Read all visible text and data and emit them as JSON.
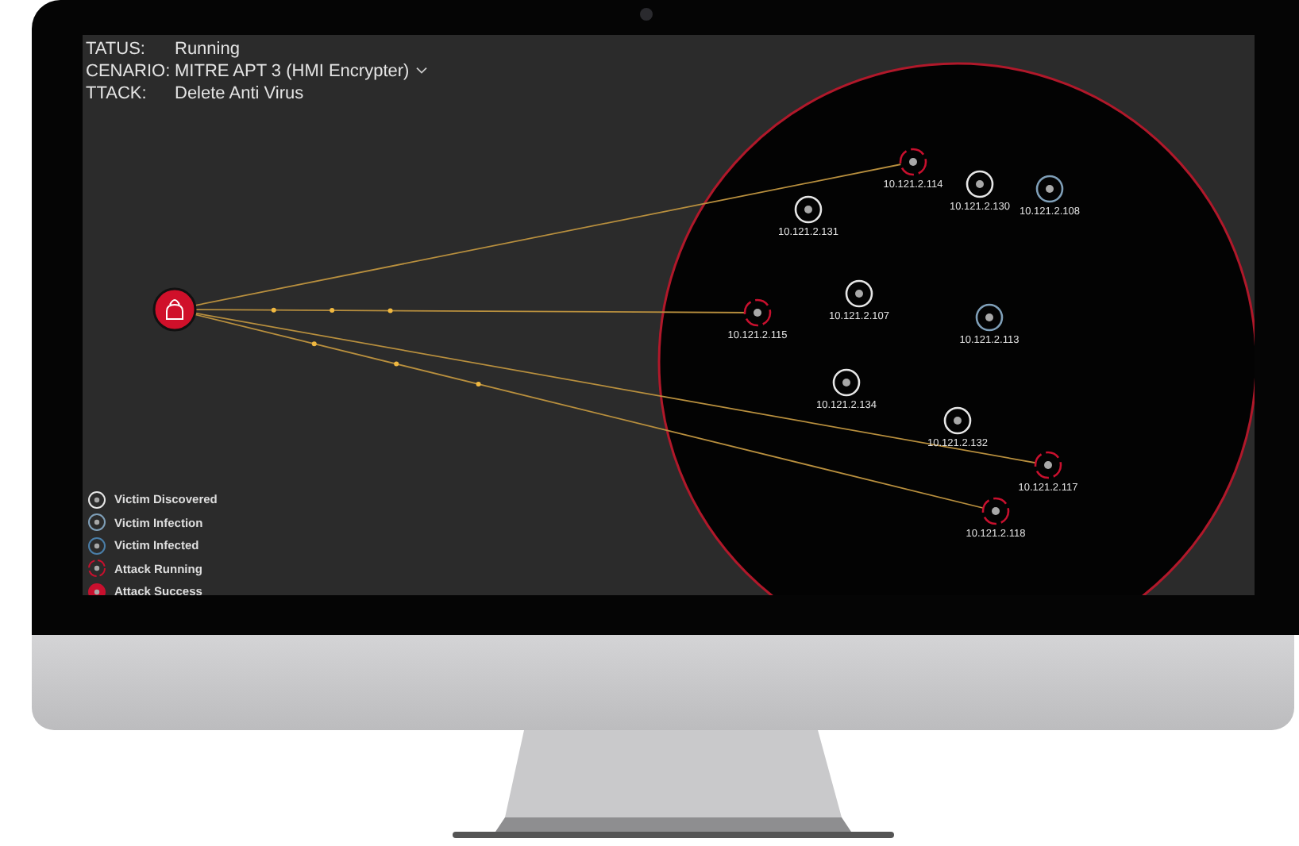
{
  "status": [
    {
      "label": "TATUS:",
      "value": "Running",
      "dropdown": false
    },
    {
      "label": "CENARIO:",
      "value": "MITRE APT 3 (HMI Encrypter)",
      "dropdown": true
    },
    {
      "label": "TTACK:",
      "value": "Delete Anti Virus",
      "dropdown": false
    }
  ],
  "nodes": [
    {
      "ip": "10.121.2.114",
      "kind": "running"
    },
    {
      "ip": "10.121.2.130",
      "kind": "discovered"
    },
    {
      "ip": "10.121.2.108",
      "kind": "infection"
    },
    {
      "ip": "10.121.2.131",
      "kind": "discovered"
    },
    {
      "ip": "10.121.2.115",
      "kind": "running"
    },
    {
      "ip": "10.121.2.107",
      "kind": "discovered"
    },
    {
      "ip": "10.121.2.113",
      "kind": "infection"
    },
    {
      "ip": "10.121.2.134",
      "kind": "discovered"
    },
    {
      "ip": "10.121.2.132",
      "kind": "discovered"
    },
    {
      "ip": "10.121.2.117",
      "kind": "running"
    },
    {
      "ip": "10.121.2.118",
      "kind": "running"
    }
  ],
  "legend": [
    {
      "label": "Victim Discovered",
      "kind": "discovered"
    },
    {
      "label": "Victim Infection",
      "kind": "infection"
    },
    {
      "label": "Victim Infected",
      "kind": "infected"
    },
    {
      "label": "Attack Running",
      "kind": "running"
    },
    {
      "label": "Attack Success",
      "kind": "success"
    }
  ]
}
